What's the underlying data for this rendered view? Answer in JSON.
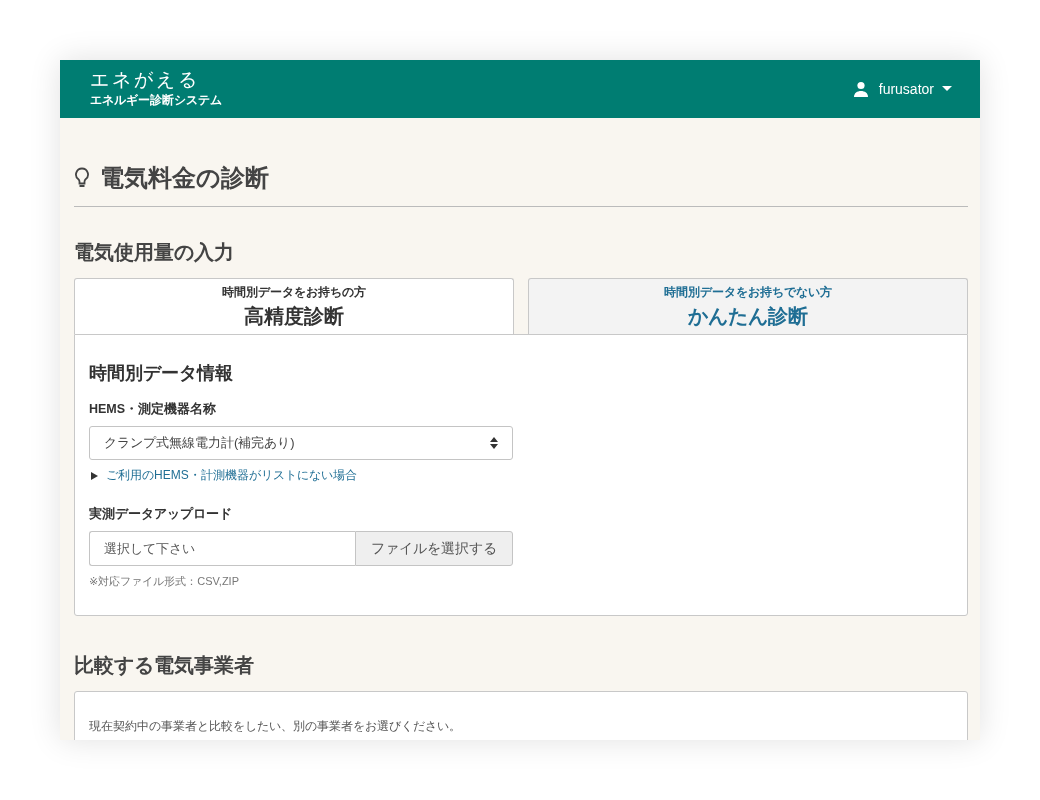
{
  "header": {
    "logo": "エネがえる",
    "subtitle": "エネルギー診断システム",
    "user": "furusator"
  },
  "page_title": "電気料金の診断",
  "usage_section": {
    "heading": "電気使用量の入力",
    "tabs": [
      {
        "caption": "時間別データをお持ちの方",
        "label": "高精度診断",
        "selected": true
      },
      {
        "caption": "時間別データをお持ちでない方",
        "label": "かんたん診断",
        "selected": false
      }
    ],
    "panel": {
      "heading": "時間別データ情報",
      "device_label": "HEMS・測定機器名称",
      "device_value": "クランプ式無線電力計(補完あり)",
      "help_link": "ご利用のHEMS・計測機器がリストにない場合",
      "upload_label": "実測データアップロード",
      "upload_placeholder": "選択して下さい",
      "upload_button": "ファイルを選択する",
      "upload_note": "※対応ファイル形式：CSV,ZIP"
    }
  },
  "compare_section": {
    "heading": "比較する電気事業者",
    "description": "現在契約中の事業者と比較をしたい、別の事業者をお選びください。"
  }
}
